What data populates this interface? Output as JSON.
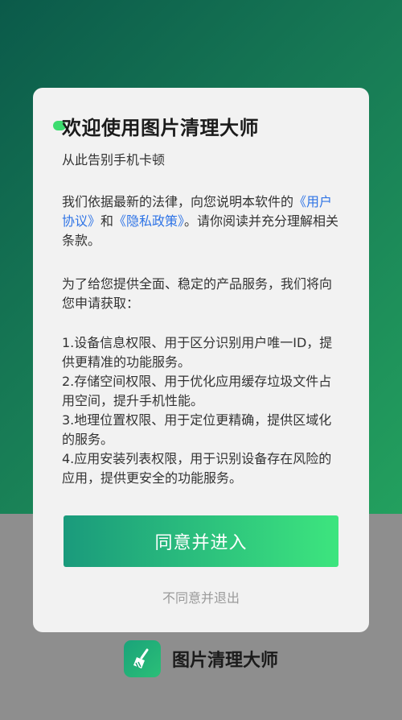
{
  "dialog": {
    "title": "欢迎使用图片清理大师",
    "subtitle": "从此告别手机卡顿",
    "intro": {
      "text_before": "我们依据最新的法律，向您说明本软件的",
      "link_user_agreement": "《用户协议》",
      "text_and": "和",
      "link_privacy": "《隐私政策》",
      "text_after": "。请你阅读并充分理解相关条款。"
    },
    "request": "为了给您提供全面、稳定的产品服务，我们将向您申请获取：",
    "permissions": [
      "1.设备信息权限、用于区分识别用户唯一ID，提供更精准的功能服务。",
      "2.存储空间权限、用于优化应用缓存垃圾文件占用空间，提升手机性能。",
      "3.地理位置权限、用于定位更精确，提供区域化的服务。",
      "4.应用安装列表权限，用于识别设备存在风险的应用，提供更安全的功能服务。"
    ],
    "agree_button": "同意并进入",
    "disagree_link": "不同意并退出"
  },
  "brand": {
    "app_name": "图片清理大师",
    "icon": "broom-icon"
  },
  "colors": {
    "accent_green": "#3de57e",
    "link_blue": "#2f74e6",
    "background_top": "#177a55",
    "background_bottom": "#8e8e8e"
  }
}
